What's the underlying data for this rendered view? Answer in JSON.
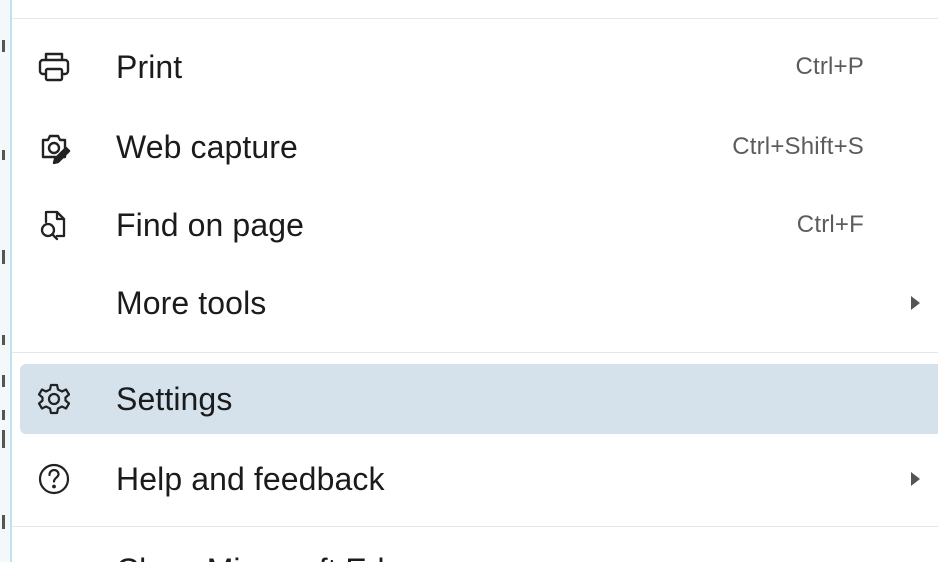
{
  "menu": {
    "items": [
      {
        "label": "Print",
        "shortcut": "Ctrl+P",
        "icon": "printer-icon"
      },
      {
        "label": "Web capture",
        "shortcut": "Ctrl+Shift+S",
        "icon": "web-capture-icon"
      },
      {
        "label": "Find on page",
        "shortcut": "Ctrl+F",
        "icon": "find-on-page-icon"
      },
      {
        "label": "More tools",
        "has_submenu": true
      },
      {
        "label": "Settings",
        "icon": "gear-icon",
        "highlighted": true
      },
      {
        "label": "Help and feedback",
        "icon": "help-icon",
        "has_submenu": true
      },
      {
        "label": "Close Microsoft Edge"
      }
    ]
  },
  "colors": {
    "highlight": "#d5e1eb",
    "text": "#1b1b1b",
    "shortcut_text": "#5c5c5c",
    "separator": "#e6e6e6"
  }
}
